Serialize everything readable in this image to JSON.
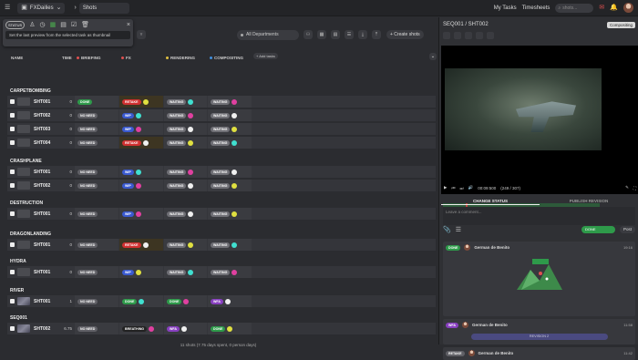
{
  "topbar": {
    "production": "FXDailies",
    "section": "Shots",
    "my_tasks": "My Tasks",
    "timesheets": "Timesheets",
    "search_placeholder": "shots..."
  },
  "popup": {
    "status_label": "STATUS",
    "tooltip": "Set the last preview from the selected task as thumbnail"
  },
  "toolbar": {
    "department": "All Departments",
    "create_shots": "+ Create shots"
  },
  "columns": {
    "name": "NAME",
    "time": "TIME",
    "depts": [
      {
        "label": "BRIEFING",
        "color": "#e05050"
      },
      {
        "label": "FX",
        "color": "#e05050"
      },
      {
        "label": "RENDERING",
        "color": "#e0c040"
      },
      {
        "label": "COMPOSITING",
        "color": "#4090e0"
      }
    ],
    "add_tasks": "+ Add tasks"
  },
  "statuses": {
    "done": {
      "label": "DONE",
      "color": "#2e9a4a"
    },
    "retake": {
      "label": "RETAKE",
      "color": "#d03030"
    },
    "wip": {
      "label": "WIP",
      "color": "#3a5ad0"
    },
    "waiting": {
      "label": "WAITING",
      "color": "#707076"
    },
    "noneed": {
      "label": "NO NEED",
      "color": "#606066"
    },
    "wfa": {
      "label": "WFA",
      "color": "#8840c0"
    },
    "breathing": {
      "label": "BREATHING",
      "color": "#222"
    }
  },
  "sequences": [
    {
      "name": "CARPETBOMBING",
      "shots": [
        {
          "name": "SHT001",
          "time": "0",
          "cells": [
            "done",
            "retake",
            "waiting",
            "waiting"
          ]
        },
        {
          "name": "SHT002",
          "time": "0",
          "cells": [
            "noneed",
            "wip",
            "waiting",
            "waiting"
          ]
        },
        {
          "name": "SHT003",
          "time": "0",
          "cells": [
            "noneed",
            "wip",
            "waiting",
            "waiting"
          ]
        },
        {
          "name": "SHT004",
          "time": "0",
          "cells": [
            "noneed",
            "retake",
            "waiting",
            "waiting"
          ]
        }
      ]
    },
    {
      "name": "CRASHPLANE",
      "shots": [
        {
          "name": "SHT001",
          "time": "0",
          "cells": [
            "noneed",
            "wip",
            "waiting",
            "waiting"
          ]
        },
        {
          "name": "SHT002",
          "time": "0",
          "cells": [
            "noneed",
            "wip",
            "waiting",
            "waiting"
          ]
        }
      ]
    },
    {
      "name": "DESTRUCTION",
      "shots": [
        {
          "name": "SHT001",
          "time": "0",
          "cells": [
            "noneed",
            "wip",
            "waiting",
            "waiting"
          ]
        }
      ]
    },
    {
      "name": "DRAGONLANDING",
      "shots": [
        {
          "name": "SHT001",
          "time": "0",
          "cells": [
            "noneed",
            "retake",
            "waiting",
            "waiting"
          ]
        }
      ]
    },
    {
      "name": "HYDRA",
      "shots": [
        {
          "name": "SHT001",
          "time": "0",
          "cells": [
            "noneed",
            "wip",
            "waiting",
            "waiting"
          ]
        }
      ]
    },
    {
      "name": "RIVER",
      "shots": [
        {
          "name": "SHT001",
          "time": "1",
          "cells": [
            "noneed",
            "done",
            "done",
            "wfa"
          ]
        }
      ]
    },
    {
      "name": "SEQ001",
      "shots": [
        {
          "name": "SHT002",
          "time": "6.75",
          "cells": [
            "noneed",
            "breathing",
            "wfa",
            "done"
          ]
        }
      ]
    }
  ],
  "footer": "11 shots (7.75 days spent, 0 person days)",
  "panel": {
    "title": "SEQ001 / SHT002",
    "task_type": "Compositing",
    "timecode": "00:09:500",
    "frames": "(249 / 307)",
    "tab_change": "CHANGE STATUS",
    "tab_publish": "PUBLISH REVISION",
    "comment_placeholder": "Leave a comment...",
    "status_select": "DONE",
    "post": "Post",
    "comments": [
      {
        "status": "DONE",
        "status_color": "#2e9a4a",
        "author": "German de Benito",
        "date": "19:16"
      },
      {
        "status": "WFA",
        "status_color": "#8840c0",
        "author": "German de Benito",
        "date": "11:58",
        "revision": "REVISION 2"
      },
      {
        "status": "RETAKE",
        "status_color": "#606066",
        "author": "German de Benito",
        "date": "11:42"
      }
    ]
  }
}
